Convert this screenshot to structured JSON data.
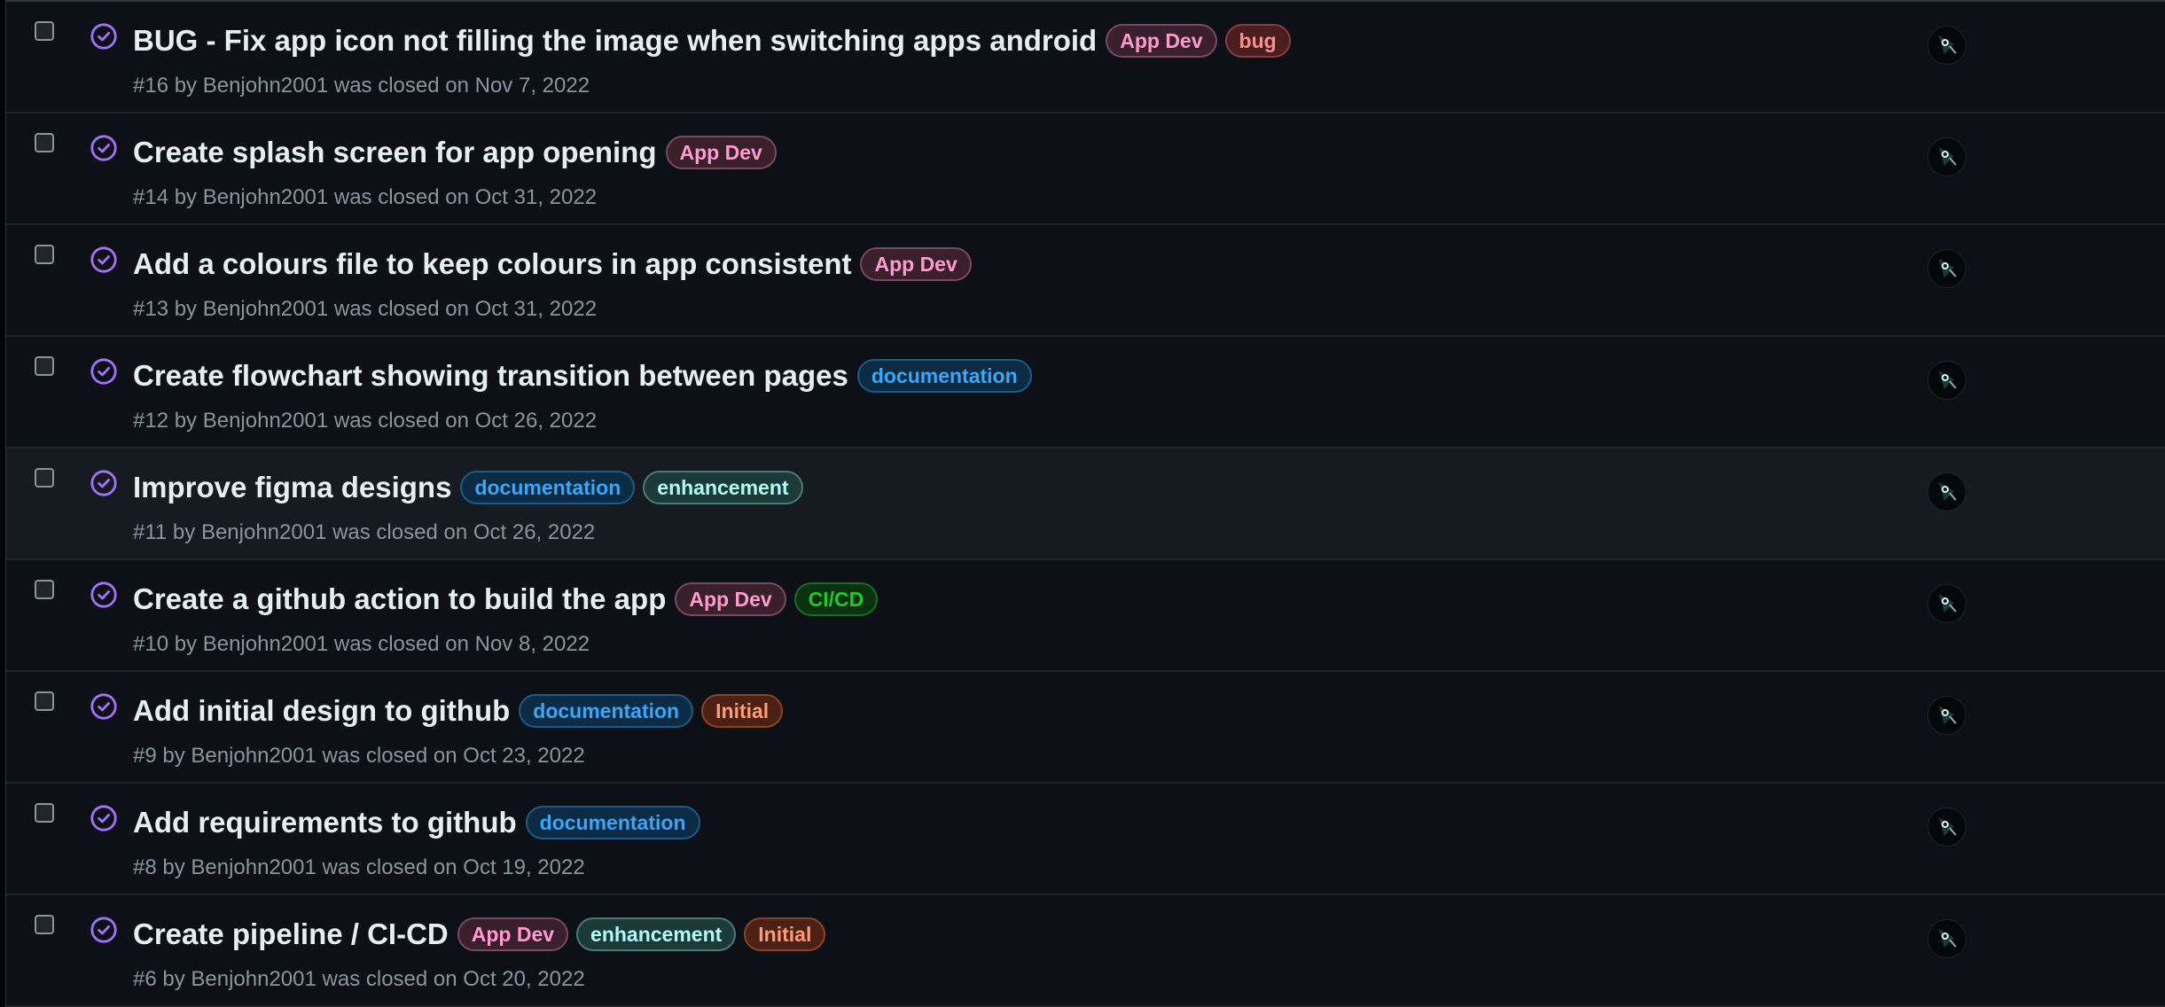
{
  "labels": {
    "App Dev": {
      "text": "#ff9bce",
      "bg": "#3a1f2d",
      "border": "#7a4862"
    },
    "bug": {
      "text": "#ff8e8a",
      "bg": "#4a1d1f",
      "border": "#8a3c3c"
    },
    "documentation": {
      "text": "#3aa7f8",
      "bg": "#0c2c46",
      "border": "#1e5a85"
    },
    "enhancement": {
      "text": "#b2fbf3",
      "bg": "#1d3a3a",
      "border": "#4c7b77"
    },
    "CI/CD": {
      "text": "#25c72e",
      "bg": "#0b3210",
      "border": "#1b6c20"
    },
    "Initial": {
      "text": "#ff9a75",
      "bg": "#4a2114",
      "border": "#8c4326"
    }
  },
  "state_icon_color": "#a371f7",
  "issues": [
    {
      "title": "BUG - Fix app icon not filling the image when switching apps android",
      "labels": [
        "App Dev",
        "bug"
      ],
      "meta": "#16 by Benjohn2001 was closed on Nov 7, 2022"
    },
    {
      "title": "Create splash screen for app opening",
      "labels": [
        "App Dev"
      ],
      "meta": "#14 by Benjohn2001 was closed on Oct 31, 2022"
    },
    {
      "title": "Add a colours file to keep colours in app consistent",
      "labels": [
        "App Dev"
      ],
      "meta": "#13 by Benjohn2001 was closed on Oct 31, 2022"
    },
    {
      "title": "Create flowchart showing transition between pages",
      "labels": [
        "documentation"
      ],
      "meta": "#12 by Benjohn2001 was closed on Oct 26, 2022"
    },
    {
      "title": "Improve figma designs",
      "labels": [
        "documentation",
        "enhancement"
      ],
      "meta": "#11 by Benjohn2001 was closed on Oct 26, 2022",
      "hovered": true
    },
    {
      "title": "Create a github action to build the app",
      "labels": [
        "App Dev",
        "CI/CD"
      ],
      "meta": "#10 by Benjohn2001 was closed on Nov 8, 2022"
    },
    {
      "title": "Add initial design to github",
      "labels": [
        "documentation",
        "Initial"
      ],
      "meta": "#9 by Benjohn2001 was closed on Oct 23, 2022"
    },
    {
      "title": "Add requirements to github",
      "labels": [
        "documentation"
      ],
      "meta": "#8 by Benjohn2001 was closed on Oct 19, 2022"
    },
    {
      "title": "Create pipeline / CI-CD",
      "labels": [
        "App Dev",
        "enhancement",
        "Initial"
      ],
      "meta": "#6 by Benjohn2001 was closed on Oct 20, 2022"
    }
  ]
}
